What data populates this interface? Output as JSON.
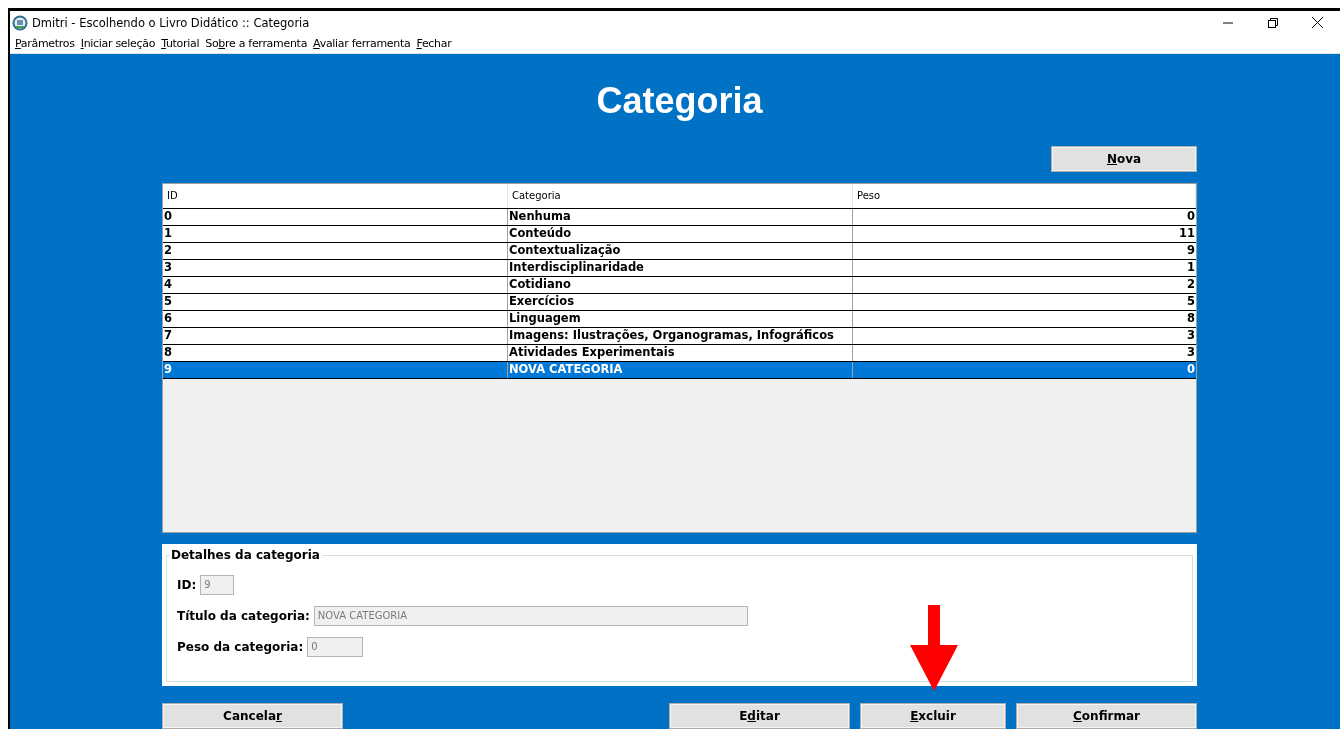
{
  "window": {
    "title": "Dmitri - Escolhendo o Livro Didático :: Categoria"
  },
  "menu": [
    {
      "label_parts": {
        "key": "P",
        "after": "arâmetros"
      }
    },
    {
      "label_parts": {
        "key": "I",
        "after": "niciar seleção"
      }
    },
    {
      "label_parts": {
        "key": "T",
        "after": "utorial"
      }
    },
    {
      "label_parts": {
        "before": "So",
        "key": "b",
        "after": "re a ferramenta"
      }
    },
    {
      "label_parts": {
        "key": "A",
        "after": "valiar ferramenta"
      }
    },
    {
      "label_parts": {
        "key": "F",
        "after": "echar"
      }
    }
  ],
  "heading": "Categoria",
  "new_button": {
    "label_parts": {
      "key": "N",
      "after": "ova"
    }
  },
  "table": {
    "columns": [
      "ID",
      "Categoria",
      "Peso"
    ],
    "rows": [
      {
        "id": "0",
        "category": "Nenhuma",
        "weight": "0",
        "selected": false
      },
      {
        "id": "1",
        "category": "Conteúdo",
        "weight": "11",
        "selected": false
      },
      {
        "id": "2",
        "category": "Contextualização",
        "weight": "9",
        "selected": false
      },
      {
        "id": "3",
        "category": "Interdisciplinaridade",
        "weight": "1",
        "selected": false
      },
      {
        "id": "4",
        "category": "Cotidiano",
        "weight": "2",
        "selected": false
      },
      {
        "id": "5",
        "category": "Exercícios",
        "weight": "5",
        "selected": false
      },
      {
        "id": "6",
        "category": "Linguagem",
        "weight": "8",
        "selected": false
      },
      {
        "id": "7",
        "category": "Imagens: Ilustrações, Organogramas, Infográficos",
        "weight": "3",
        "selected": false
      },
      {
        "id": "8",
        "category": "Atividades Experimentais",
        "weight": "3",
        "selected": false
      },
      {
        "id": "9",
        "category": "NOVA CATEGORIA",
        "weight": "0",
        "selected": true
      }
    ]
  },
  "details": {
    "legend": "Detalhes da categoria",
    "fields": [
      {
        "label": "ID:",
        "value": "9",
        "disabled": true
      },
      {
        "label": "Título da categoria:",
        "value": "NOVA CATEGORIA",
        "disabled": true
      },
      {
        "label": "Peso da categoria:",
        "value": "0",
        "disabled": true
      }
    ]
  },
  "buttons": [
    {
      "label_parts": {
        "before": "Cancela",
        "key": "r"
      }
    },
    {
      "label_parts": {
        "before": "E",
        "key": "d",
        "after": "itar"
      }
    },
    {
      "label_parts": {
        "key": "E",
        "after": "xcluir"
      }
    },
    {
      "label_parts": {
        "key": "C",
        "after": "onfirmar"
      }
    }
  ],
  "annotation": {
    "kind": "arrow"
  }
}
